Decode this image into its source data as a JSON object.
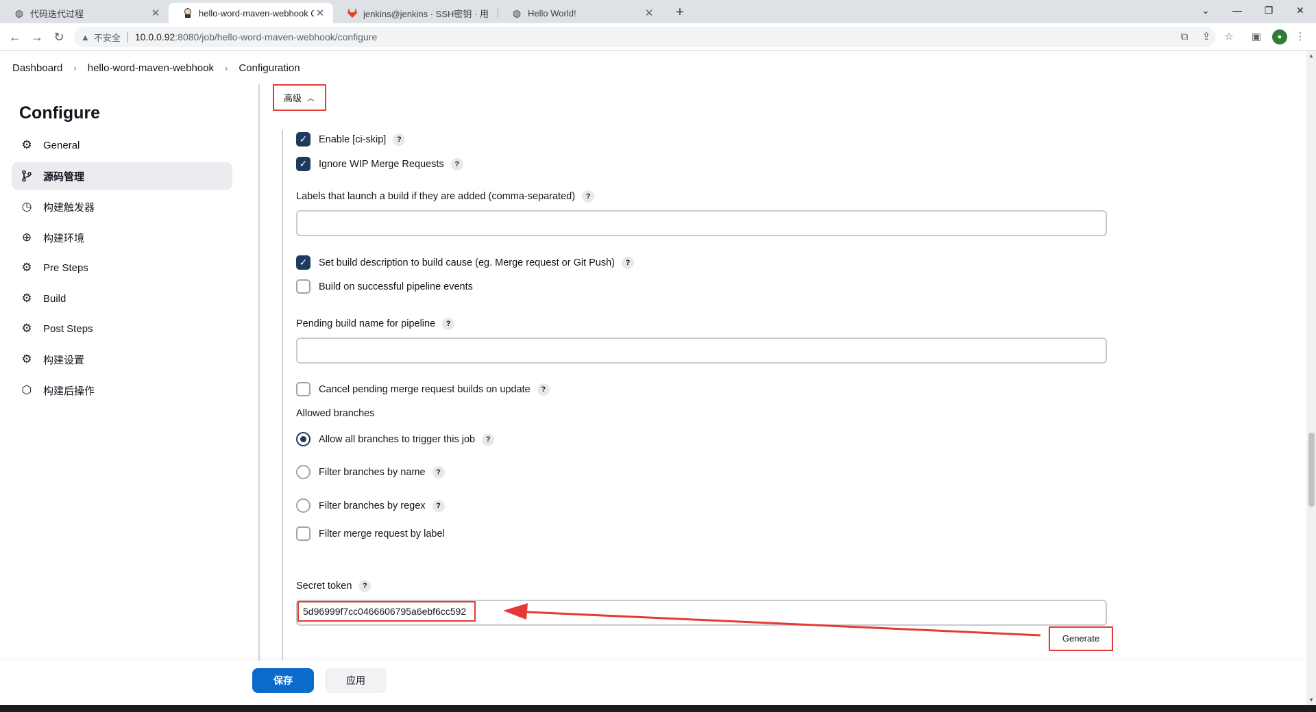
{
  "browser": {
    "tabs": [
      {
        "title": "代码迭代过程",
        "favicon": "globe-icon"
      },
      {
        "title": "hello-word-maven-webhook C",
        "favicon": "jenkins-icon"
      },
      {
        "title": "jenkins@jenkins · SSH密钥 · 用",
        "favicon": "gitlab-icon"
      },
      {
        "title": "Hello World!",
        "favicon": "globe-icon"
      }
    ],
    "tab_close": "✕",
    "new_tab": "+",
    "security_label": "不安全",
    "url_host": "10.0.0.92",
    "url_path": ":8080/job/hello-word-maven-webhook/configure"
  },
  "breadcrumb": {
    "items": [
      "Dashboard",
      "hello-word-maven-webhook",
      "Configuration"
    ],
    "separator": "›"
  },
  "sidebar": {
    "title": "Configure",
    "items": [
      {
        "label": "General",
        "icon": "gear-icon",
        "active": false
      },
      {
        "label": "源码管理",
        "icon": "branch-icon",
        "active": true
      },
      {
        "label": "构建触发器",
        "icon": "clock-icon",
        "active": false
      },
      {
        "label": "构建环境",
        "icon": "globe-icon",
        "active": false
      },
      {
        "label": "Pre Steps",
        "icon": "gear-icon",
        "active": false
      },
      {
        "label": "Build",
        "icon": "gear-icon",
        "active": false
      },
      {
        "label": "Post Steps",
        "icon": "gear-icon",
        "active": false
      },
      {
        "label": "构建设置",
        "icon": "gear-icon",
        "active": false
      },
      {
        "label": "构建后操作",
        "icon": "cube-icon",
        "active": false
      }
    ]
  },
  "advanced": {
    "label": "高级"
  },
  "options": {
    "enable_ci_skip": {
      "label": "Enable [ci-skip]",
      "checked": true
    },
    "ignore_wip": {
      "label": "Ignore WIP Merge Requests",
      "checked": true
    },
    "labels_label": "Labels that launch a build if they are added (comma-separated)",
    "labels_value": "",
    "set_build_desc": {
      "label": "Set build description to build cause (eg. Merge request or Git Push)",
      "checked": true
    },
    "build_on_pipeline": {
      "label": "Build on successful pipeline events",
      "checked": false
    },
    "pending_name_label": "Pending build name for pipeline",
    "pending_name_value": "",
    "cancel_pending": {
      "label": "Cancel pending merge request builds on update",
      "checked": false
    },
    "allowed_branches_label": "Allowed branches",
    "branch_options": [
      {
        "label": "Allow all branches to trigger this job",
        "selected": true
      },
      {
        "label": "Filter branches by name",
        "selected": false
      },
      {
        "label": "Filter branches by regex",
        "selected": false
      }
    ],
    "filter_by_label": {
      "label": "Filter merge request by label",
      "checked": false
    },
    "secret_token_label": "Secret token",
    "secret_token_value": "5d96999f7cc0466606795a6ebf6cc592",
    "generate_label": "Generate"
  },
  "help_glyph": "?",
  "footer": {
    "save_label": "保存",
    "apply_label": "应用"
  },
  "colors": {
    "highlight": "#e53935",
    "primary": "#0b6bcb",
    "checkbox": "#1e3a5f"
  }
}
